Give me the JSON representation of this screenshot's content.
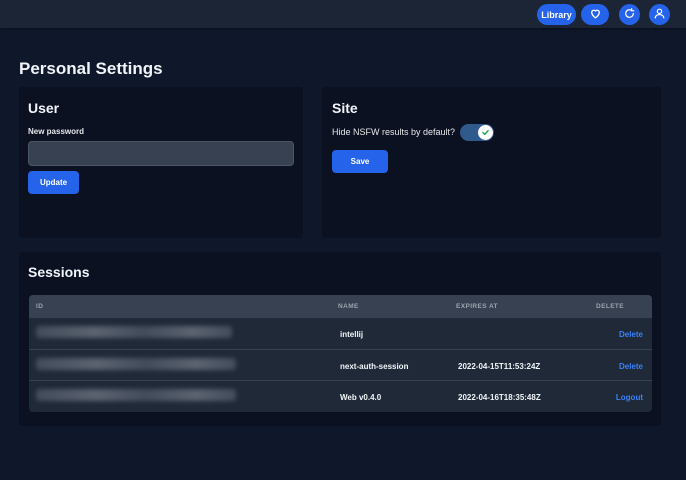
{
  "topbar": {
    "library_label": "Library",
    "icons": [
      "heart-icon",
      "refresh-icon",
      "user-icon"
    ]
  },
  "page": {
    "title": "Personal Settings"
  },
  "user_card": {
    "title": "User",
    "password_label": "New password",
    "password_value": "",
    "update_label": "Update"
  },
  "site_card": {
    "title": "Site",
    "nsfw_label": "Hide NSFW results by default?",
    "nsfw_enabled": true,
    "save_label": "Save"
  },
  "sessions": {
    "title": "Sessions",
    "columns": {
      "id": "ID",
      "name": "NAME",
      "expires": "EXPIRES AT",
      "delete": "DELETE"
    },
    "rows": [
      {
        "name": "intellij",
        "expires": "",
        "action": "Delete"
      },
      {
        "name": "next-auth-session",
        "expires": "2022-04-15T11:53:24Z",
        "action": "Delete"
      },
      {
        "name": "Web v0.4.0",
        "expires": "2022-04-16T18:35:48Z",
        "action": "Logout"
      }
    ]
  },
  "colors": {
    "accent": "#2563eb",
    "link": "#3b82f6",
    "background": "#0f172a",
    "card": "#0b1120",
    "topbar": "#1c2535"
  }
}
